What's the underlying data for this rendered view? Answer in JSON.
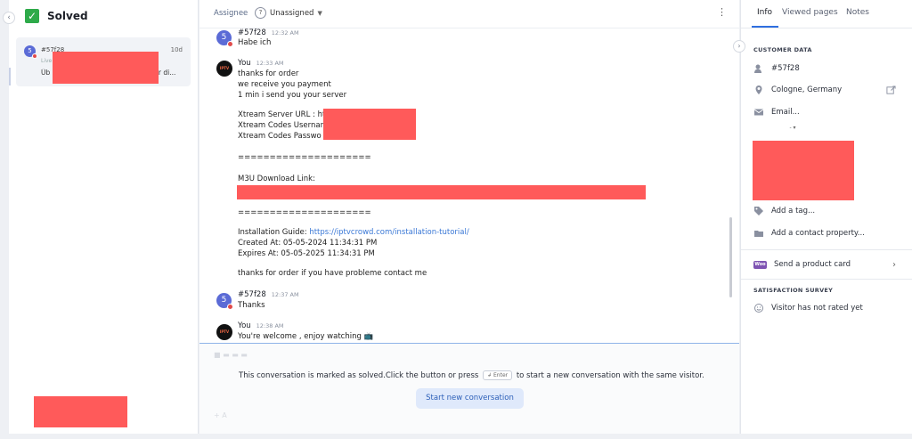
{
  "left_panel": {
    "collapse_icon": "chevron-left-icon",
    "title": "Solved",
    "conversation": {
      "avatar_letter": "5",
      "id": "#57f28",
      "time": "10d",
      "status": "Live",
      "preview_start": "Üb",
      "preview_end": "er di..."
    }
  },
  "header": {
    "assignee_label": "Assignee",
    "assignee_value": "Unassigned",
    "assignee_icon": "question-icon"
  },
  "messages": [
    {
      "sender": "#57f28",
      "time": "12:32 AM",
      "avatar": "5",
      "lines": [
        "Habe ich"
      ]
    },
    {
      "sender": "You",
      "time": "12:33 AM",
      "avatar": "IPTV",
      "lines": [
        "thanks for order",
        "we receive you payment",
        "1 min i send you your server",
        "",
        "Xtream Server URL : ht",
        "Xtream Codes Usernar",
        "Xtream Codes Passwo",
        "",
        "=====================",
        "",
        "M3U Download Link:",
        "",
        "",
        "=====================",
        "",
        "Installation Guide: ",
        "Created At: 05-05-2024 11:34:31 PM",
        "Expires At: 05-05-2025 11:34:31 PM",
        "",
        "thanks for order if you have probleme contact me"
      ],
      "guide_link": "https://iptvcrowd.com/installation-tutorial/"
    },
    {
      "sender": "#57f28",
      "time": "12:37 AM",
      "avatar": "5",
      "lines": [
        "Thanks"
      ]
    },
    {
      "sender": "You",
      "time": "12:38 AM",
      "avatar": "IPTV",
      "lines": [
        "You're welcome , enjoy watching 📺"
      ]
    }
  ],
  "composer": {
    "solved_notice_before": "This conversation is marked as solved.Click the button or press",
    "key_label": "Enter",
    "solved_notice_after": "to start a new conversation with the same visitor.",
    "start_button": "Start new conversation"
  },
  "right_panel": {
    "tabs": [
      "Info",
      "Viewed pages",
      "Notes"
    ],
    "customer_data_title": "CUSTOMER DATA",
    "customer_id": "#57f28",
    "location": "Cologne, Germany",
    "email_placeholder": "Email...",
    "stepper": "- ▾",
    "add_tag": "Add a tag...",
    "add_property": "Add a contact property...",
    "send_product": "Send a product card",
    "woo_label": "Woo",
    "survey_title": "SATISFACTION SURVEY",
    "survey_status": "Visitor has not rated yet"
  },
  "colors": {
    "accent": "#2f6fe0",
    "solved_green": "#2eaa4a",
    "redaction": "#ff5a5a",
    "avatar_purple": "#5b6bd6"
  }
}
